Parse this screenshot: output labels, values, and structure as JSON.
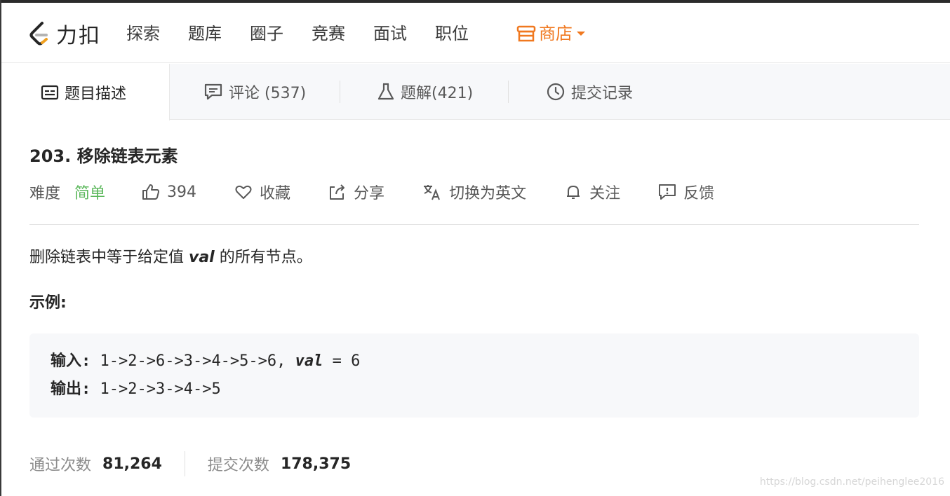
{
  "nav": {
    "logo_text": "力扣",
    "items": [
      "探索",
      "题库",
      "圈子",
      "竞赛",
      "面试",
      "职位"
    ],
    "store_label": "商店"
  },
  "tabs": [
    {
      "label": "题目描述"
    },
    {
      "label": "评论 (537)"
    },
    {
      "label": "题解(421)"
    },
    {
      "label": "提交记录"
    }
  ],
  "problem": {
    "title": "203. 移除链表元素",
    "difficulty_label": "难度",
    "difficulty_value": "简单",
    "likes": "394",
    "favorite_label": "收藏",
    "share_label": "分享",
    "translate_label": "切换为英文",
    "follow_label": "关注",
    "feedback_label": "反馈",
    "desc_before": "删除链表中等于给定值 ",
    "desc_em": "val",
    "desc_after": " 的所有节点。",
    "example_label": "示例:",
    "input_label": "输入:",
    "input_value": "1->2->6->3->4->5->6,",
    "input_val_kw": "val",
    "input_eq": " = 6",
    "output_label": "输出:",
    "output_value": "1->2->3->4->5"
  },
  "stats": {
    "accepted_label": "通过次数",
    "accepted_value": "81,264",
    "submitted_label": "提交次数",
    "submitted_value": "178,375"
  },
  "watermark": "https://blog.csdn.net/peihenglee2016",
  "colors": {
    "accent_store": "#f0781f",
    "difficulty_easy": "#5cb85c",
    "logo_orange": "#f0a020"
  }
}
